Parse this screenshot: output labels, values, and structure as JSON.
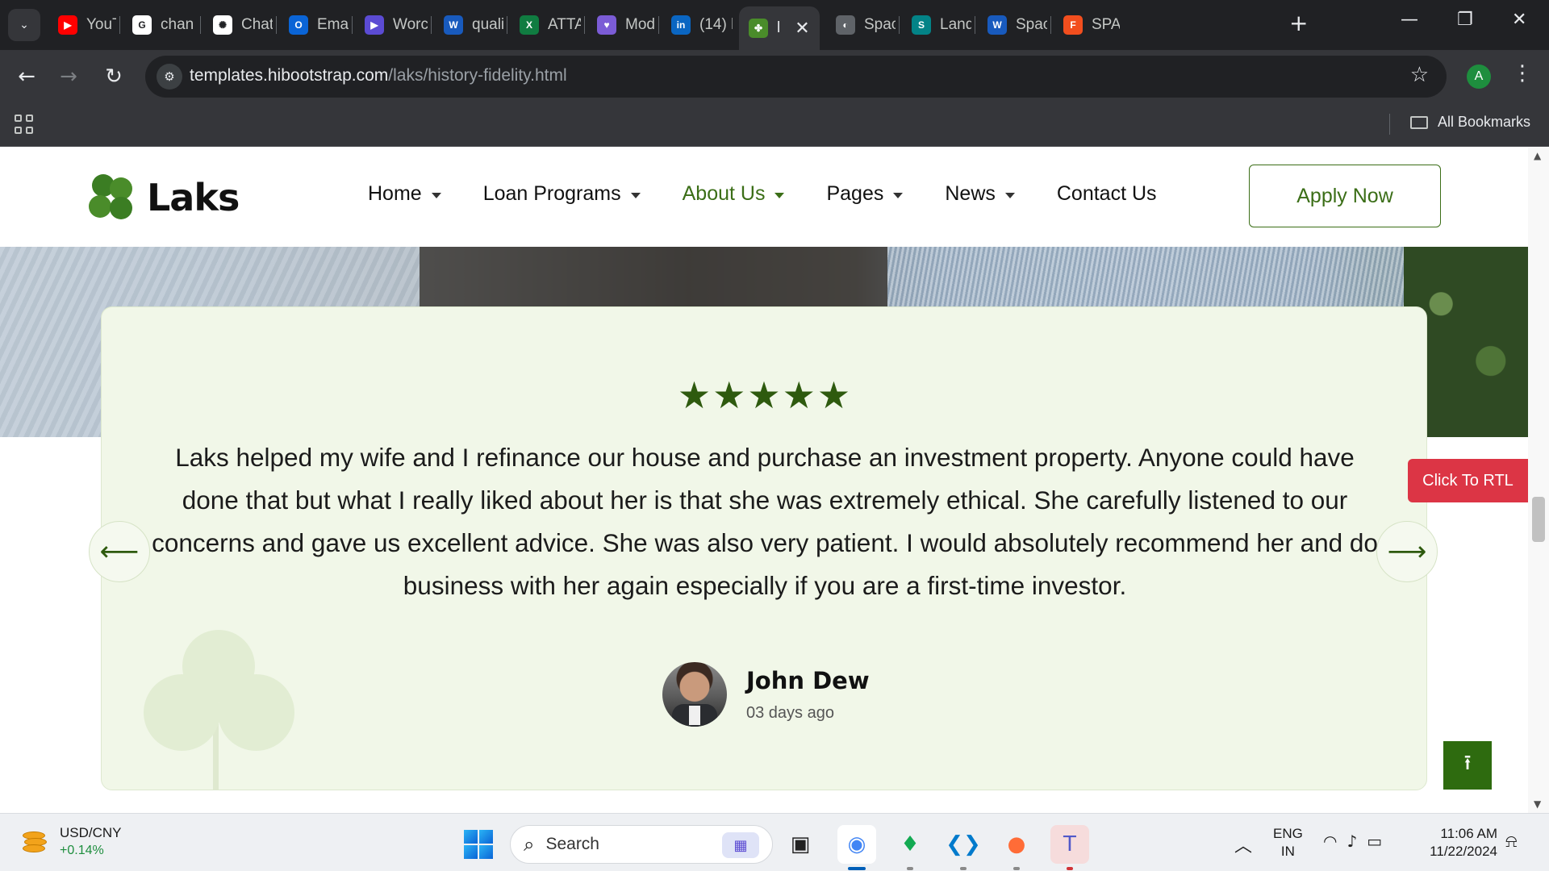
{
  "browser": {
    "tabs": [
      {
        "label": "YouT",
        "color": "#ff0000",
        "glyph": "▶"
      },
      {
        "label": "chan",
        "color": "#ffffff",
        "glyph": "G"
      },
      {
        "label": "Chat",
        "color": "#ffffff",
        "glyph": "✺"
      },
      {
        "label": "Emai",
        "color": "#0a64d6",
        "glyph": "O"
      },
      {
        "label": "Worc",
        "color": "#5b4bd3",
        "glyph": "▶"
      },
      {
        "label": "quali",
        "color": "#185abd",
        "glyph": "W"
      },
      {
        "label": "ATTA",
        "color": "#107c41",
        "glyph": "X"
      },
      {
        "label": "Mod",
        "color": "#7b5cd6",
        "glyph": "♥"
      },
      {
        "label": "(14) l",
        "color": "#0a66c2",
        "glyph": "in"
      },
      {
        "label": "l",
        "color": "#4a8c2a",
        "glyph": "✤"
      },
      {
        "label": "Spac",
        "color": "#5f6368",
        "glyph": "◐"
      },
      {
        "label": "Land",
        "color": "#038387",
        "glyph": "S"
      },
      {
        "label": "Spac",
        "color": "#185abd",
        "glyph": "W"
      },
      {
        "label": "SPAC",
        "color": "#f24e1e",
        "glyph": "F"
      }
    ],
    "active_tab_index": 9,
    "url_host": "templates.hibootstrap.com",
    "url_path": "/laks/history-fidelity.html",
    "profile_initial": "A",
    "bookmarks_label": "All Bookmarks"
  },
  "site": {
    "logo_text": "Laks",
    "nav": [
      {
        "label": "Home",
        "dropdown": true
      },
      {
        "label": "Loan Programs",
        "dropdown": true
      },
      {
        "label": "About Us",
        "dropdown": true,
        "active": true
      },
      {
        "label": "Pages",
        "dropdown": true
      },
      {
        "label": "News",
        "dropdown": true
      },
      {
        "label": "Contact Us",
        "dropdown": false
      }
    ],
    "apply_button": "Apply Now",
    "accent_color": "#3b6e17"
  },
  "testimonial": {
    "rating": 5,
    "stars": "★★★★★",
    "quote": "Laks helped my wife and I refinance our house and purchase an investment property. Anyone could have done that but what I really liked about her is that she was extremely ethical. She carefully listened to our concerns and gave us excellent advice. She was also very patient. I would absolutely recommend her and do business with her again especially if you are a first-time investor.",
    "author_name": "John Dew",
    "author_time": "03 days ago",
    "prev_icon": "arrow-left",
    "next_icon": "arrow-right"
  },
  "floating": {
    "rtl_button": "Click To RTL",
    "back_to_top_icon": "arrow-up"
  },
  "taskbar": {
    "widget_title": "USD/CNY",
    "widget_value": "+0.14%",
    "search_label": "Search",
    "language_line1": "ENG",
    "language_line2": "IN",
    "time": "11:06 AM",
    "date": "11/22/2024"
  }
}
